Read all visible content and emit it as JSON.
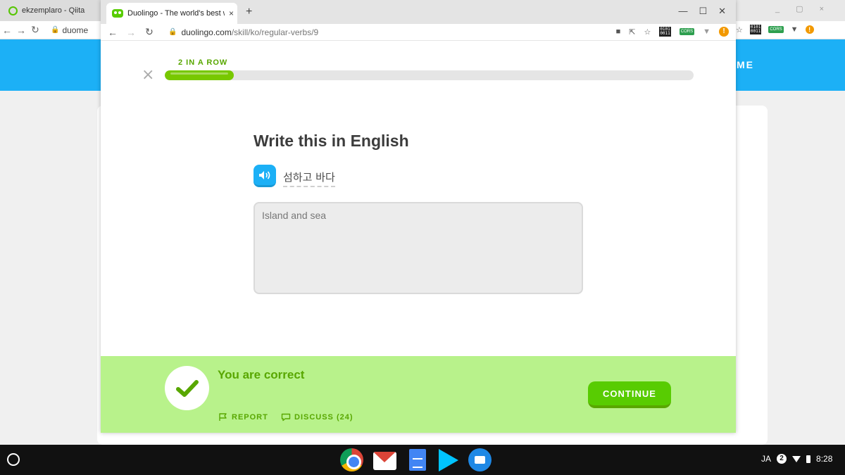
{
  "background_window": {
    "tab_title": "ekzemplaro - Qiita",
    "url": "duome",
    "banner_text": "ME"
  },
  "browser": {
    "tab_title": "Duolingo - The world's best wa",
    "tab_close": "×",
    "new_tab": "+",
    "url_host": "duolingo.com",
    "url_path": "/skill/ko/regular-verbs/9",
    "ext_binary": "0101\n0011",
    "ext_cors": "CORS",
    "ext_alert": "!"
  },
  "lesson": {
    "streak_label": "2 IN A ROW",
    "progress": 0.13,
    "close_symbol": "×",
    "challenge_title": "Write this in English",
    "prompt": "섬하고 바다",
    "answer": "Island and sea"
  },
  "feedback": {
    "title": "You are correct",
    "report_label": "REPORT",
    "discuss_label": "DISCUSS (24)",
    "continue_label": "CONTINUE"
  },
  "shelf": {
    "ime": "JA",
    "notification_count": "2",
    "time": "8:28"
  },
  "colors": {
    "duolingo_green": "#58cc02",
    "correct_bg": "#b8f28b",
    "correct_text": "#58a700",
    "progress_fill": "#78c800",
    "speaker_blue": "#1cb0f6"
  }
}
